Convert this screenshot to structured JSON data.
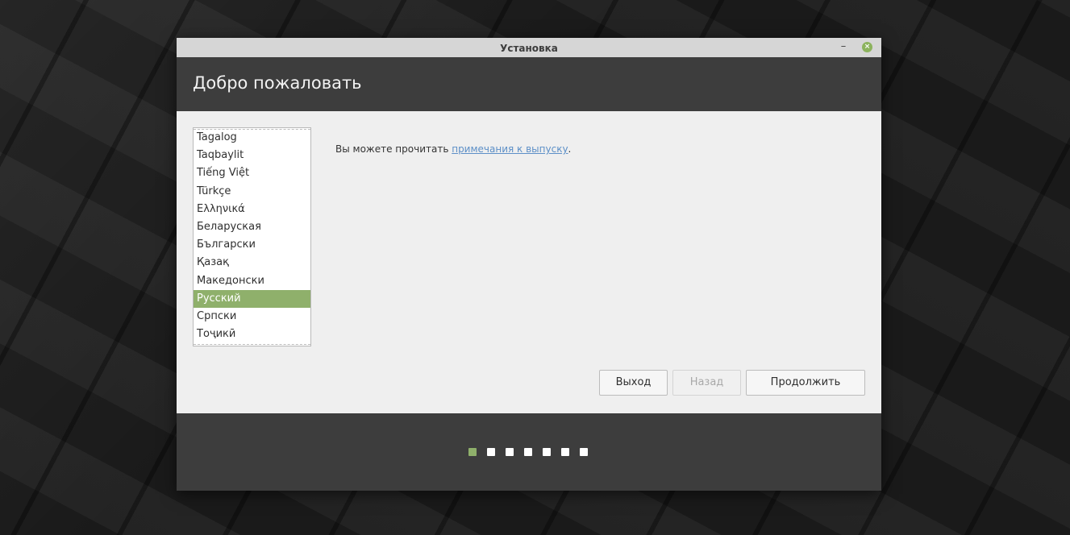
{
  "window": {
    "title": "Установка",
    "minimize_label": "–",
    "close_label": "×"
  },
  "header": {
    "title": "Добро пожаловать"
  },
  "languages": {
    "items": [
      "Tagalog",
      "Taqbaylit",
      "Tiếng Việt",
      "Türkçe",
      "Ελληνικά",
      "Беларуская",
      "Български",
      "Қазақ",
      "Македонски",
      "Русский",
      "Српски",
      "Тоҷикӣ"
    ],
    "selected": "Русский"
  },
  "content": {
    "release_prefix": "Вы можете прочитать ",
    "release_link": "примечания к выпуску",
    "release_suffix": "."
  },
  "buttons": {
    "quit": "Выход",
    "back": "Назад",
    "continue": "Продолжить"
  },
  "progress": {
    "total_steps": 7,
    "current_step": 1
  },
  "colors": {
    "accent": "#8fb06b",
    "link": "#5c8fc7",
    "header_bg": "#3d3d3d"
  }
}
